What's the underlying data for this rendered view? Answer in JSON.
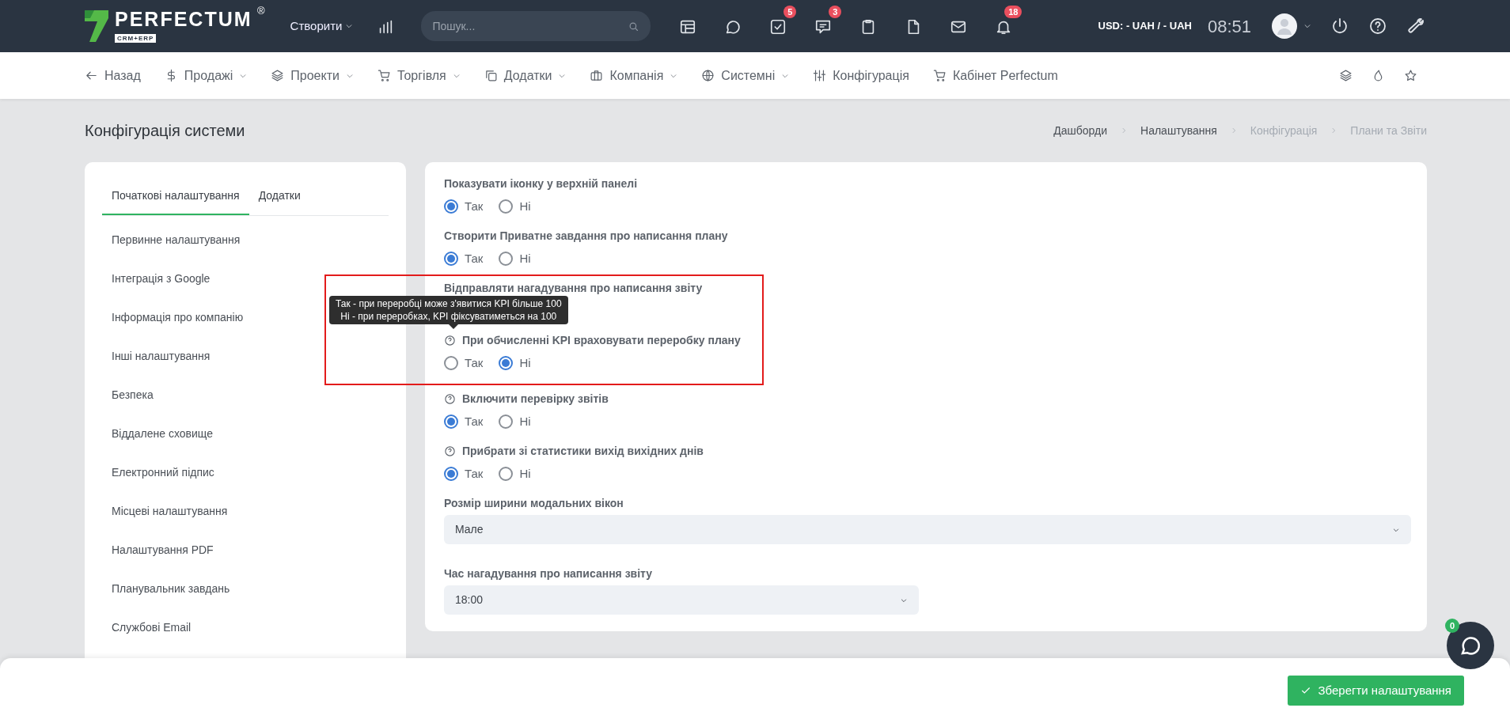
{
  "topbar": {
    "logo": {
      "name": "PERFECTUM",
      "mark": "®",
      "tagline": "CRM+ERP"
    },
    "create_menu": "Створити",
    "search": {
      "placeholder": "Пошук..."
    },
    "icons": [
      {
        "kind": "calendar"
      },
      {
        "kind": "chat"
      },
      {
        "kind": "tasks",
        "badge": "5"
      },
      {
        "kind": "messages",
        "badge": "3"
      },
      {
        "kind": "clipboard"
      },
      {
        "kind": "file"
      },
      {
        "kind": "mail"
      },
      {
        "kind": "bell",
        "badge": "18"
      }
    ],
    "currency": "USD: - UAH / - UAH",
    "time": "08:51"
  },
  "nav": [
    {
      "kind": "back",
      "label": "Назад",
      "dropdown": false
    },
    {
      "kind": "dollar",
      "label": "Продажі",
      "dropdown": true
    },
    {
      "kind": "layers",
      "label": "Проекти",
      "dropdown": true
    },
    {
      "kind": "cart",
      "label": "Торгівля",
      "dropdown": true
    },
    {
      "kind": "copy",
      "label": "Додатки",
      "dropdown": true
    },
    {
      "kind": "briefcase",
      "label": "Компанія",
      "dropdown": true
    },
    {
      "kind": "globe",
      "label": "Системні",
      "dropdown": true
    },
    {
      "kind": "sliders",
      "label": "Конфігурація",
      "dropdown": false
    },
    {
      "kind": "cart",
      "label": "Кабінет Perfectum",
      "dropdown": false
    }
  ],
  "page_title": "Конфігурація системи",
  "breadcrumb": [
    {
      "label": "Дашборди",
      "muted": false
    },
    {
      "label": "Налаштування",
      "muted": false
    },
    {
      "label": "Конфігурація",
      "muted": true
    },
    {
      "label": "Плани та Звіти",
      "muted": true
    }
  ],
  "sidebar": {
    "tabs": [
      {
        "label": "Початкові налаштування",
        "selected": true
      },
      {
        "label": "Додатки",
        "selected": false
      }
    ],
    "items": [
      "Первинне налаштування",
      "Інтеграція з Google",
      "Інформація про компанію",
      "Інші налаштування",
      "Безпека",
      "Віддалене сховище",
      "Електронний підпис",
      "Місцеві налаштування",
      "Налаштування PDF",
      "Планувальник завдань",
      "Службові Email"
    ]
  },
  "settings": [
    {
      "kind": "radio",
      "label": "Показувати іконку у верхній панелі",
      "help": false,
      "highlighted": false,
      "options": [
        {
          "label": "Так",
          "selected": true
        },
        {
          "label": "Ні",
          "selected": false
        }
      ]
    },
    {
      "kind": "radio",
      "label": "Створити Приватне завдання про написання плану",
      "help": false,
      "highlighted": false,
      "options": [
        {
          "label": "Так",
          "selected": true
        },
        {
          "label": "Ні",
          "selected": false
        }
      ]
    },
    {
      "kind": "radio",
      "label": "Відправляти нагадування про написання звіту",
      "help": false,
      "highlighted": true
    },
    {
      "kind": "radio",
      "label": "При обчисленні KPI враховувати переробку плану",
      "help": true,
      "highlighted": true,
      "tooltip": [
        "Так - при переробці може з'явитися KPI більше 100",
        "Ні - при переробках, KPI фіксуватиметься на 100"
      ],
      "options": [
        {
          "label": "Так",
          "selected": false
        },
        {
          "label": "Ні",
          "selected": true
        }
      ]
    },
    {
      "kind": "radio",
      "label": "Включити перевірку звітів",
      "help": true,
      "highlighted": false,
      "options": [
        {
          "label": "Так",
          "selected": true
        },
        {
          "label": "Ні",
          "selected": false
        }
      ]
    },
    {
      "kind": "radio",
      "label": "Прибрати зі статистики вихід вихідних днів",
      "help": true,
      "highlighted": false,
      "options": [
        {
          "label": "Так",
          "selected": true
        },
        {
          "label": "Ні",
          "selected": false
        }
      ]
    },
    {
      "kind": "select",
      "label": "Розмір ширини модальних вікон",
      "value": "Мале",
      "wide": true
    },
    {
      "kind": "select",
      "label": "Час нагадування про написання звіту",
      "value": "18:00",
      "wide": false
    }
  ],
  "save_button": "Зберегти налаштування",
  "chat_badge": "0"
}
